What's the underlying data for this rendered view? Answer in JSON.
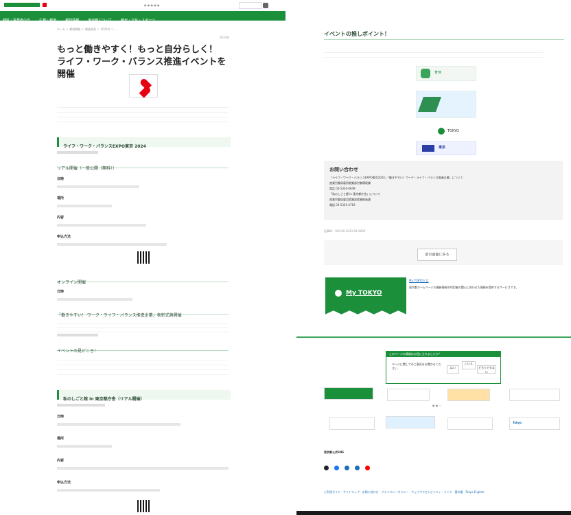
{
  "left": {
    "title": "もっと働きやすく！もっと自分らしく！ ライフ・ワーク・バランス推進イベントを開催",
    "nav": [
      "都民・事業者の方",
      "広報・報道",
      "都政情報",
      "東京都について",
      "観光・文化・スポーツ"
    ],
    "sections": [
      {
        "heading": "ライフ・ワーク・バランスEXPO東京 2024",
        "sub": "リアル開催（一般公開（無料））"
      },
      {
        "heading": "オンライン開催"
      },
      {
        "heading": "「働きやすい！ ワーク・ライフ・バランス推進企業」表彰式典開催"
      },
      {
        "heading": "イベントの見どころ！"
      },
      {
        "heading": "私のしごと館 in 東京都庁舎（リアル開催）"
      }
    ],
    "labels": {
      "date": "日時",
      "place": "場所",
      "content": "内容",
      "apply": "申込方法"
    }
  },
  "right": {
    "event_points_title": "イベントの推しポイント！",
    "contact_title": "お問い合わせ",
    "contact_lines": [
      "「ライフ・ワーク・バランスEXPO東京2024」「働きやすい！ワーク・ライフ・バランス推進企業」について",
      "産業労働局雇用就業部労働環境課",
      "電話 03-5320-4649",
      "「私のしごと館 in 東京都庁舎」について",
      "産業労働局雇用就業部就業推進課",
      "電話 03-5320-4719"
    ],
    "article_id": "記事ID：000-00-2023-02-0000",
    "button_label": "前の画面に戻る",
    "mytokyo_title": "My TOKYO",
    "mytokyo_link": "My TOKYOとは",
    "mytokyo_desc": "東京都ホームページの最新情報や利用者の関心に合わせた情報を提供するサービスです。",
    "survey": {
      "header": "このページの情報はお役に立ちましたか？",
      "question": "ページに関してのご意見をお聞かせください",
      "buttons": [
        "はい",
        "いいえ",
        "どちらでもない"
      ]
    },
    "sns_title": "東京都公式SNS",
    "footer_links": [
      "ご利用ガイド",
      "サイトマップ",
      "お問い合わせ",
      "プライバシーポリシー",
      "ウェブアクセシビリティ",
      "リンク",
      "著作権",
      "Tokyo English"
    ]
  },
  "colors": {
    "brand_green": "#1b8f3a",
    "accent_red": "#e60012"
  }
}
